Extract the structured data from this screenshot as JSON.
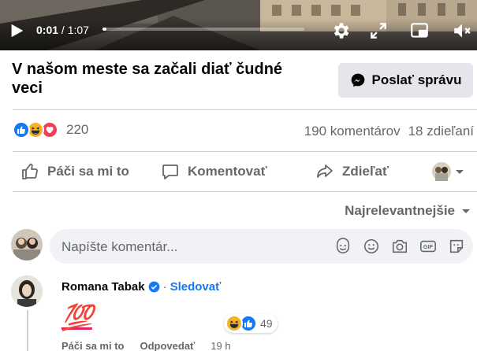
{
  "video": {
    "current_time": "0:01",
    "duration": "1:07",
    "progress": 0.015,
    "icons": [
      "play-icon",
      "settings-icon",
      "fullscreen-icon",
      "picture-in-picture-icon",
      "mute-icon"
    ]
  },
  "post": {
    "title": "V našom meste sa začali diať čudné veci",
    "send_message_label": "Poslať správu"
  },
  "reactions": {
    "types": [
      "like",
      "haha",
      "love"
    ],
    "count": "220",
    "comments": "190 komentárov",
    "shares": "18 zdieľaní"
  },
  "actions": {
    "like": "Páči sa mi to",
    "comment": "Komentovať",
    "share": "Zdieľať"
  },
  "sort": {
    "label": "Najrelevantnejšie"
  },
  "composer": {
    "placeholder": "Napíšte komentár...",
    "tools": [
      "sticker-icon",
      "emoji-icon",
      "camera-icon",
      "gif-icon",
      "sticker-alt-icon"
    ]
  },
  "comment": {
    "author": "Romana Tabak",
    "separator": "·",
    "follow": "Sledovať",
    "text": "💯",
    "reaction_count": "49",
    "like": "Páči sa mi to",
    "reply": "Odpovedať",
    "time": "19 h"
  },
  "colors": {
    "accent": "#1877f2",
    "like_blue": "#1877f2",
    "haha_yellow": "#f7b125",
    "love_red": "#f33e58",
    "muted_text": "#65676b",
    "button_bg": "#e4e6eb",
    "input_bg": "#f0f2f5"
  }
}
